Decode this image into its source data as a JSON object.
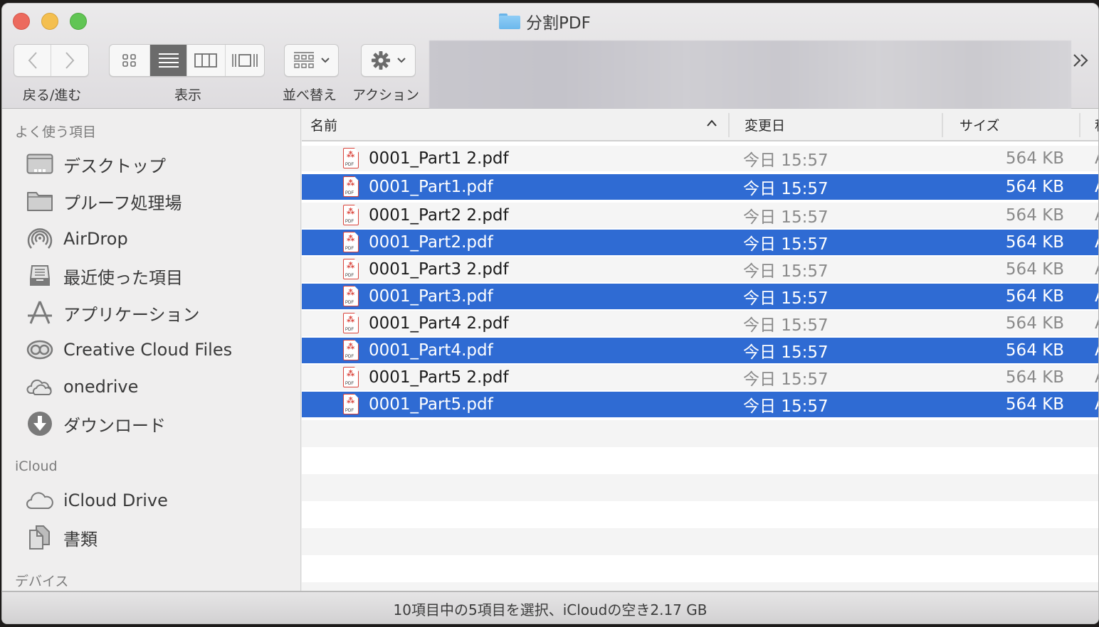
{
  "window": {
    "title": "分割PDF",
    "title_icon": "folder-icon"
  },
  "toolbar": {
    "nav": {
      "back_icon": "chevron-left-icon",
      "forward_icon": "chevron-right-icon",
      "label": "戻る/進む"
    },
    "view": {
      "label": "表示",
      "modes": [
        {
          "name": "icon-view",
          "glyph": "▫▫",
          "active": false
        },
        {
          "name": "list-view",
          "glyph": "≡",
          "active": true
        },
        {
          "name": "column-view",
          "glyph": "▥",
          "active": false
        },
        {
          "name": "gallery-view",
          "glyph": "⊡",
          "active": false
        }
      ]
    },
    "arrange": {
      "label": "並べ替え",
      "icon": "arrange-grid-icon"
    },
    "action": {
      "label": "アクション",
      "icon": "gear-icon"
    },
    "overflow": "»"
  },
  "sidebar": {
    "sections": [
      {
        "title": "よく使う項目",
        "items": [
          {
            "label": "デスクトップ",
            "icon": "desktop-icon"
          },
          {
            "label": "プルーフ処理場",
            "icon": "folder-icon"
          },
          {
            "label": "AirDrop",
            "icon": "airdrop-icon"
          },
          {
            "label": "最近使った項目",
            "icon": "recents-icon"
          },
          {
            "label": "アプリケーション",
            "icon": "applications-icon"
          },
          {
            "label": "Creative Cloud Files",
            "icon": "creative-cloud-icon"
          },
          {
            "label": "onedrive",
            "icon": "cloud-icon"
          },
          {
            "label": "ダウンロード",
            "icon": "download-icon"
          }
        ]
      },
      {
        "title": "iCloud",
        "items": [
          {
            "label": "iCloud Drive",
            "icon": "icloud-icon"
          },
          {
            "label": "書類",
            "icon": "documents-icon"
          }
        ]
      },
      {
        "title": "デバイス",
        "items": []
      }
    ]
  },
  "list": {
    "columns": {
      "name": "名前",
      "date": "変更日",
      "size": "サイズ",
      "kind": "種"
    },
    "sort": {
      "column": "name",
      "direction": "ascending"
    },
    "files": [
      {
        "name": "0001_Part1 2.pdf",
        "date": "今日 15:57",
        "size": "564 KB",
        "kind": "A",
        "selected": false
      },
      {
        "name": "0001_Part1.pdf",
        "date": "今日 15:57",
        "size": "564 KB",
        "kind": "A",
        "selected": true
      },
      {
        "name": "0001_Part2 2.pdf",
        "date": "今日 15:57",
        "size": "564 KB",
        "kind": "A",
        "selected": false
      },
      {
        "name": "0001_Part2.pdf",
        "date": "今日 15:57",
        "size": "564 KB",
        "kind": "A",
        "selected": true
      },
      {
        "name": "0001_Part3 2.pdf",
        "date": "今日 15:57",
        "size": "564 KB",
        "kind": "A",
        "selected": false
      },
      {
        "name": "0001_Part3.pdf",
        "date": "今日 15:57",
        "size": "564 KB",
        "kind": "A",
        "selected": true
      },
      {
        "name": "0001_Part4 2.pdf",
        "date": "今日 15:57",
        "size": "564 KB",
        "kind": "A",
        "selected": false
      },
      {
        "name": "0001_Part4.pdf",
        "date": "今日 15:57",
        "size": "564 KB",
        "kind": "A",
        "selected": true
      },
      {
        "name": "0001_Part5 2.pdf",
        "date": "今日 15:57",
        "size": "564 KB",
        "kind": "A",
        "selected": false
      },
      {
        "name": "0001_Part5.pdf",
        "date": "今日 15:57",
        "size": "564 KB",
        "kind": "A",
        "selected": true
      }
    ]
  },
  "status": {
    "text": "10項目中の5項目を選択、iCloudの空き2.17 GB"
  },
  "colors": {
    "selection": "#2f6bd3",
    "close": "#ec6a5e",
    "minimize": "#f4bf4f",
    "maximize": "#61c554",
    "pdf_accent": "#d9433a"
  }
}
